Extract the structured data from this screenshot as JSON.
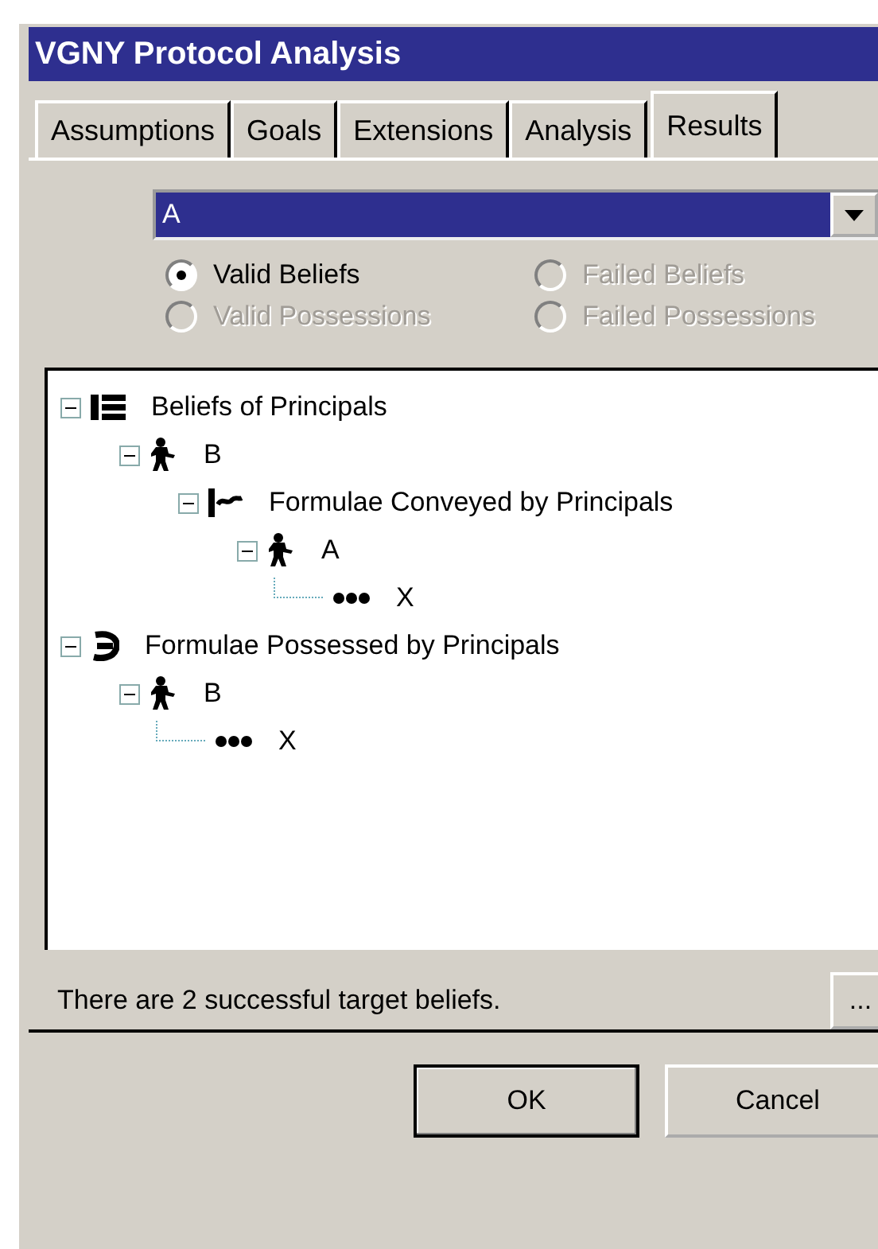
{
  "window": {
    "title": "VGNY Protocol Analysis"
  },
  "tabs": [
    {
      "label": "Assumptions",
      "selected": false
    },
    {
      "label": "Goals",
      "selected": false
    },
    {
      "label": "Extensions",
      "selected": false
    },
    {
      "label": "Analysis",
      "selected": false
    },
    {
      "label": "Results",
      "selected": true
    }
  ],
  "principal_select": {
    "value": "A"
  },
  "radios": [
    {
      "label": "Valid Beliefs",
      "selected": true,
      "disabled": false
    },
    {
      "label": "Failed Beliefs",
      "selected": false,
      "disabled": true
    },
    {
      "label": "Valid Possessions",
      "selected": false,
      "disabled": true
    },
    {
      "label": "Failed Possessions",
      "selected": false,
      "disabled": true
    }
  ],
  "tree": [
    {
      "kind": "beliefs",
      "label": "Beliefs of Principals",
      "expanded": true,
      "children": [
        {
          "kind": "principal",
          "label": "B",
          "expanded": true,
          "children": [
            {
              "kind": "conveyed",
              "label": "Formulae Conveyed by Principals",
              "expanded": true,
              "children": [
                {
                  "kind": "principal",
                  "label": "A",
                  "expanded": true,
                  "children": [
                    {
                      "kind": "formula",
                      "label": "X"
                    }
                  ]
                }
              ]
            }
          ]
        }
      ]
    },
    {
      "kind": "possessed",
      "label": "Formulae Possessed by Principals",
      "expanded": true,
      "children": [
        {
          "kind": "principal",
          "label": "B",
          "expanded": true,
          "children": [
            {
              "kind": "formula",
              "label": "X"
            }
          ]
        }
      ]
    }
  ],
  "status": {
    "text": "There are 2 successful target beliefs.",
    "button": "..."
  },
  "buttons": [
    {
      "label": "OK",
      "default": true
    },
    {
      "label": "Cancel",
      "default": false
    }
  ]
}
